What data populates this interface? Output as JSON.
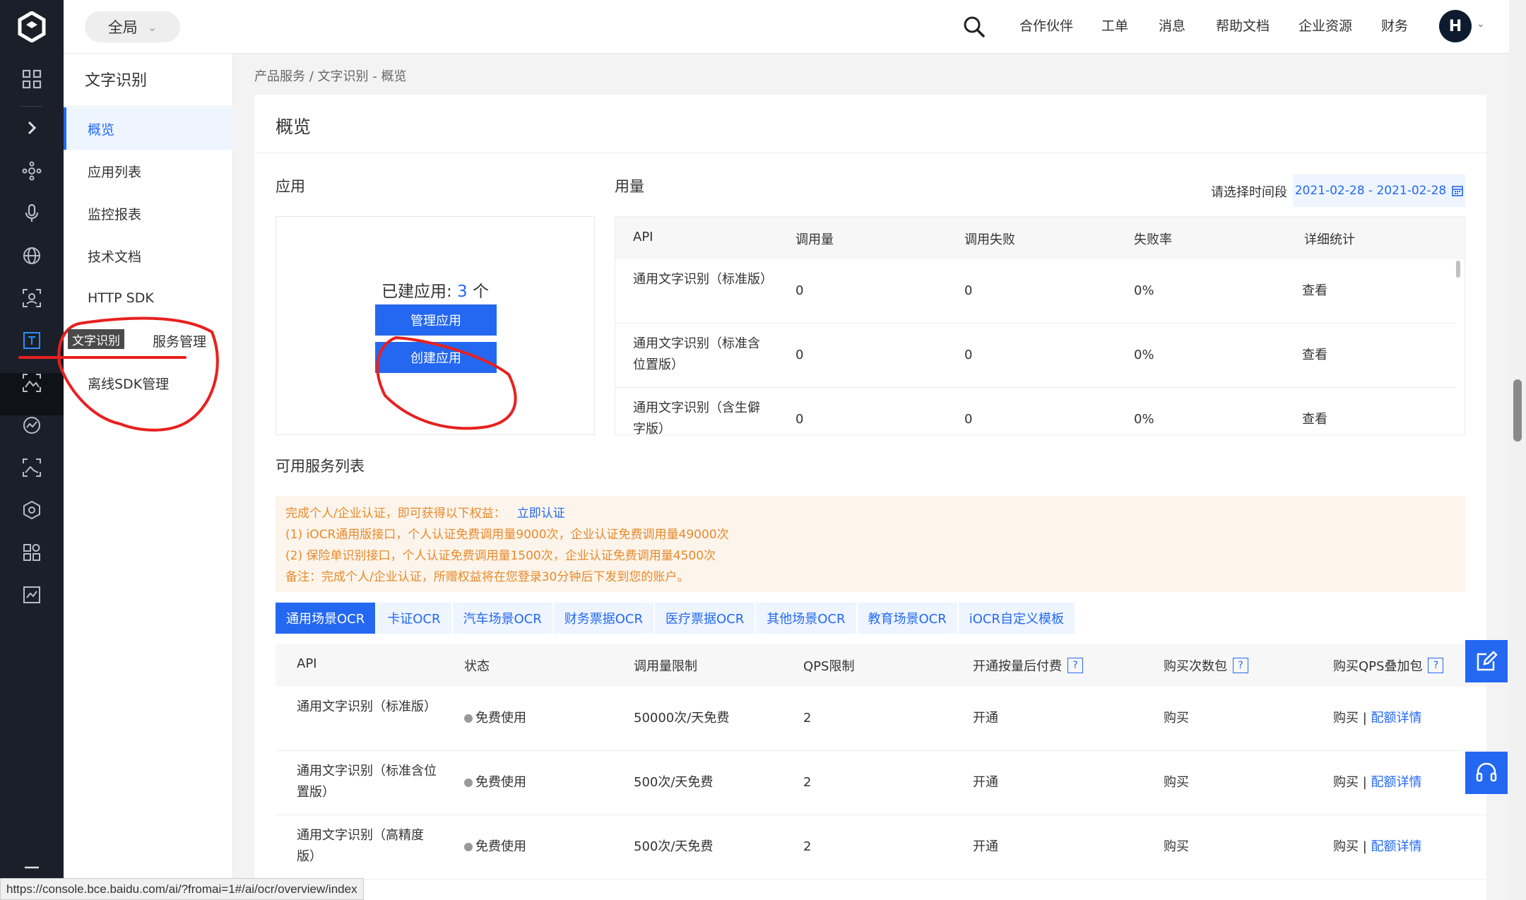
{
  "topbar": {
    "region": "全局",
    "nav": [
      "合作伙伴",
      "工单",
      "消息",
      "帮助文档",
      "企业资源",
      "财务"
    ],
    "avatar_initial": "H"
  },
  "sidebar": {
    "title": "文字识别",
    "items": [
      {
        "label": "概览",
        "active": true
      },
      {
        "label": "应用列表"
      },
      {
        "label": "监控报表"
      },
      {
        "label": "技术文档"
      },
      {
        "label": "HTTP SDK"
      },
      {
        "label": "私有服务管理"
      },
      {
        "label": "离线SDK管理"
      }
    ],
    "tooltip": "文字识别",
    "private_label_visible": "服务管理"
  },
  "breadcrumb": "产品服务  /  文字识别 - 概览",
  "page": {
    "title": "概览",
    "apps_section": "应用",
    "apps_count_prefix": "已建应用: ",
    "apps_count": "3",
    "apps_count_suffix": " 个",
    "manage_btn": "管理应用",
    "create_btn": "创建应用",
    "usage_section": "用量",
    "date_label": "请选择时间段",
    "date_range": "2021-02-28 - 2021-02-28"
  },
  "usage_table": {
    "columns": [
      "API",
      "调用量",
      "调用失败",
      "失败率",
      "详细统计"
    ],
    "rows": [
      {
        "api": "通用文字识别（标准版）",
        "calls": "0",
        "failed": "0",
        "rate": "0%",
        "detail": "查看"
      },
      {
        "api": "通用文字识别（标准含位置版）",
        "calls": "0",
        "failed": "0",
        "rate": "0%",
        "detail": "查看"
      },
      {
        "api": "通用文字识别（含生僻字版）",
        "calls": "0",
        "failed": "0",
        "rate": "0%",
        "detail": "查看"
      }
    ]
  },
  "services": {
    "title": "可用服务列表",
    "notice": {
      "line1": "完成个人/企业认证，即可获得以下权益：",
      "link": "立即认证",
      "line2": "(1) iOCR通用版接口，个人认证免费调用量9000次，企业认证免费调用量49000次",
      "line3": "(2) 保险单识别接口，个人认证免费调用量1500次，企业认证免费调用量4500次",
      "line4": "备注：完成个人/企业认证，所赠权益将在您登录30分钟后下发到您的账户。"
    },
    "tabs": [
      "通用场景OCR",
      "卡证OCR",
      "汽车场景OCR",
      "财务票据OCR",
      "医疗票据OCR",
      "其他场景OCR",
      "教育场景OCR",
      "iOCR自定义模板"
    ],
    "columns": [
      "API",
      "状态",
      "调用量限制",
      "QPS限制",
      "开通按量后付费",
      "购买次数包",
      "购买QPS叠加包"
    ],
    "rows": [
      {
        "api": "通用文字识别（标准版）",
        "status": "免费使用",
        "limit": "50000次/天免费",
        "qps": "2",
        "open": "开通",
        "buy": "购买",
        "qps_buy": "购买",
        "quota": "配额详情"
      },
      {
        "api": "通用文字识别（标准含位置版）",
        "status": "免费使用",
        "limit": "500次/天免费",
        "qps": "2",
        "open": "开通",
        "buy": "购买",
        "qps_buy": "购买",
        "quota": "配额详情"
      },
      {
        "api": "通用文字识别（高精度版）",
        "status": "免费使用",
        "limit": "500次/天免费",
        "qps": "2",
        "open": "开通",
        "buy": "购买",
        "qps_buy": "购买",
        "quota": "配额详情"
      }
    ]
  },
  "status_url": "https://console.bce.baidu.com/ai/?fromai=1#/ai/ocr/overview/index",
  "colors": {
    "accent": "#2468f2",
    "rail": "#1b1f29",
    "annotation": "#e8201e",
    "notice_text": "#e8892a"
  }
}
